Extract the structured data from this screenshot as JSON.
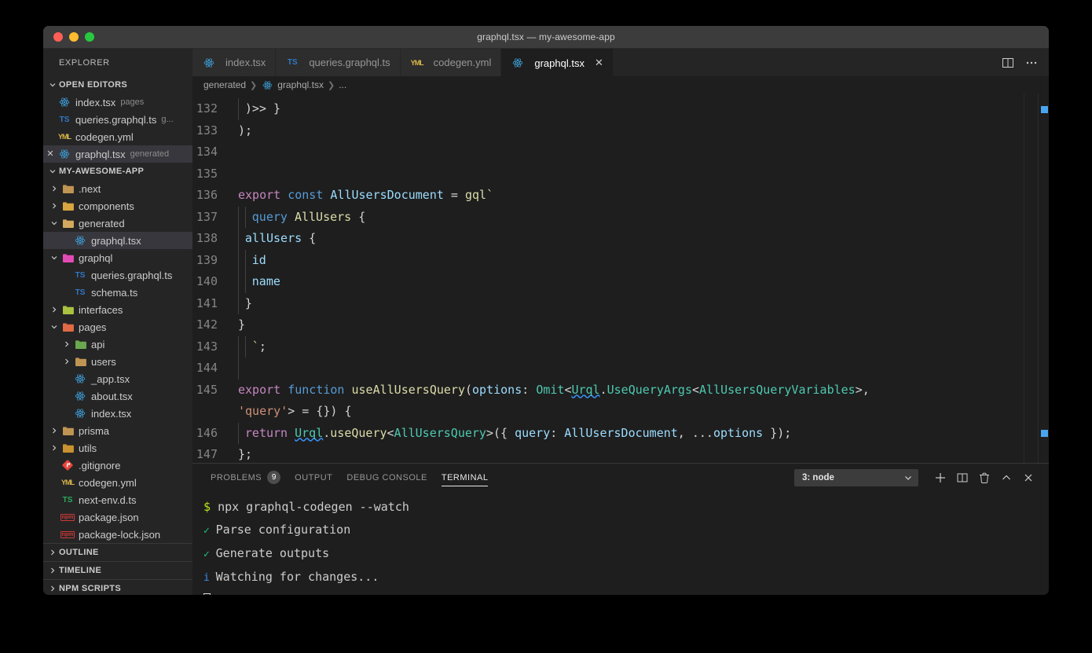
{
  "window": {
    "title": "graphql.tsx — my-awesome-app",
    "traffic_lights": [
      "close",
      "minimize",
      "zoom"
    ]
  },
  "sidebar": {
    "title": "EXPLORER",
    "sections": [
      {
        "name": "OPEN EDITORS",
        "expanded": true
      },
      {
        "name": "MY-AWESOME-APP",
        "expanded": true
      },
      {
        "name": "OUTLINE",
        "expanded": false
      },
      {
        "name": "TIMELINE",
        "expanded": false
      },
      {
        "name": "NPM SCRIPTS",
        "expanded": false
      }
    ],
    "open_editors": [
      {
        "label": "index.tsx",
        "desc": "pages",
        "icon": "react-icon",
        "closable": false,
        "active": false
      },
      {
        "label": "queries.graphql.ts",
        "desc": "g...",
        "icon": "ts-icon",
        "closable": false,
        "active": false
      },
      {
        "label": "codegen.yml",
        "desc": "",
        "icon": "yaml-icon",
        "closable": false,
        "active": false
      },
      {
        "label": "graphql.tsx",
        "desc": "generated",
        "icon": "react-icon",
        "closable": true,
        "active": true
      }
    ],
    "tree": [
      {
        "label": ".next",
        "icon": "folder-icon",
        "depth": 1,
        "twisty": "right",
        "selected": false
      },
      {
        "label": "components",
        "icon": "folder-components-icon",
        "depth": 1,
        "twisty": "right",
        "selected": false
      },
      {
        "label": "generated",
        "icon": "folder-open-icon",
        "depth": 1,
        "twisty": "down",
        "selected": false
      },
      {
        "label": "graphql.tsx",
        "icon": "react-icon",
        "depth": 2,
        "twisty": "none",
        "selected": true
      },
      {
        "label": "graphql",
        "icon": "folder-graphql-icon",
        "depth": 1,
        "twisty": "down",
        "selected": false
      },
      {
        "label": "queries.graphql.ts",
        "icon": "ts-icon",
        "depth": 2,
        "twisty": "none",
        "selected": false
      },
      {
        "label": "schema.ts",
        "icon": "ts-icon",
        "depth": 2,
        "twisty": "none",
        "selected": false
      },
      {
        "label": "interfaces",
        "icon": "folder-interfaces-icon",
        "depth": 1,
        "twisty": "right",
        "selected": false
      },
      {
        "label": "pages",
        "icon": "folder-pages-icon",
        "depth": 1,
        "twisty": "down",
        "selected": false
      },
      {
        "label": "api",
        "icon": "folder-api-icon",
        "depth": 2,
        "twisty": "right",
        "selected": false
      },
      {
        "label": "users",
        "icon": "folder-icon",
        "depth": 2,
        "twisty": "right",
        "selected": false
      },
      {
        "label": "_app.tsx",
        "icon": "react-icon",
        "depth": 2,
        "twisty": "none",
        "selected": false
      },
      {
        "label": "about.tsx",
        "icon": "react-icon",
        "depth": 2,
        "twisty": "none",
        "selected": false
      },
      {
        "label": "index.tsx",
        "icon": "react-icon",
        "depth": 2,
        "twisty": "none",
        "selected": false
      },
      {
        "label": "prisma",
        "icon": "folder-icon",
        "depth": 1,
        "twisty": "right",
        "selected": false
      },
      {
        "label": "utils",
        "icon": "folder-utils-icon",
        "depth": 1,
        "twisty": "right",
        "selected": false
      },
      {
        "label": ".gitignore",
        "icon": "git-icon",
        "depth": 1,
        "twisty": "none",
        "selected": false
      },
      {
        "label": "codegen.yml",
        "icon": "yaml-icon",
        "depth": 1,
        "twisty": "none",
        "selected": false
      },
      {
        "label": "next-env.d.ts",
        "icon": "dts-icon",
        "depth": 1,
        "twisty": "none",
        "selected": false
      },
      {
        "label": "package.json",
        "icon": "npm-icon",
        "depth": 1,
        "twisty": "none",
        "selected": false
      },
      {
        "label": "package-lock.json",
        "icon": "npm-icon",
        "depth": 1,
        "twisty": "none",
        "selected": false
      }
    ]
  },
  "editor": {
    "tabs": [
      {
        "label": "index.tsx",
        "icon": "react-icon",
        "active": false,
        "dirty": false
      },
      {
        "label": "queries.graphql.ts",
        "icon": "ts-icon",
        "active": false,
        "dirty": false
      },
      {
        "label": "codegen.yml",
        "icon": "yaml-icon",
        "active": false,
        "dirty": false
      },
      {
        "label": "graphql.tsx",
        "icon": "react-icon",
        "active": true,
        "dirty": false
      }
    ],
    "actions": [
      "split-editor-icon",
      "more-actions-icon"
    ],
    "breadcrumbs": [
      "generated",
      "graphql.tsx",
      "..."
    ],
    "first_line": 132,
    "lines": [
      {
        "n": 132,
        "text": ")>> }"
      },
      {
        "n": 133,
        "text": ");"
      },
      {
        "n": 134,
        "text": ""
      },
      {
        "n": 135,
        "text": ""
      },
      {
        "n": 136,
        "text": "export const AllUsersDocument = gql`"
      },
      {
        "n": 137,
        "text": "    query AllUsers {"
      },
      {
        "n": 138,
        "text": "  allUsers {"
      },
      {
        "n": 139,
        "text": "    id"
      },
      {
        "n": 140,
        "text": "    name"
      },
      {
        "n": 141,
        "text": "  }"
      },
      {
        "n": 142,
        "text": "}"
      },
      {
        "n": 143,
        "text": "    `;"
      },
      {
        "n": 144,
        "text": ""
      },
      {
        "n": 145,
        "text": "export function useAllUsersQuery(options: Omit<Urql.UseQueryArgs<AllUsersQueryVariables>, 'query'> = {}) {"
      },
      {
        "n": 146,
        "text": "  return Urql.useQuery<AllUsersQuery>({ query: AllUsersDocument, ...options });"
      },
      {
        "n": 147,
        "text": "};"
      }
    ]
  },
  "panel": {
    "tabs": [
      {
        "label": "PROBLEMS",
        "badge": "9",
        "active": false
      },
      {
        "label": "OUTPUT",
        "badge": "",
        "active": false
      },
      {
        "label": "DEBUG CONSOLE",
        "badge": "",
        "active": false
      },
      {
        "label": "TERMINAL",
        "badge": "",
        "active": true
      }
    ],
    "terminal_select": "3: node",
    "actions": [
      "new-terminal-icon",
      "split-terminal-icon",
      "kill-terminal-icon",
      "maximize-panel-icon",
      "close-panel-icon"
    ],
    "terminal_lines": [
      {
        "marker": "$",
        "marker_kind": "prompt",
        "text": "npx graphql-codegen --watch"
      },
      {
        "marker": "✓",
        "marker_kind": "check",
        "text": "Parse configuration"
      },
      {
        "marker": "✓",
        "marker_kind": "check",
        "text": "Generate outputs"
      },
      {
        "marker": "i",
        "marker_kind": "info",
        "text": "Watching for changes..."
      }
    ]
  },
  "colors": {
    "accent_blue": "#3794ff",
    "editor_bg": "#1e1e1e",
    "sidebar_bg": "#252526",
    "titlebar_bg": "#3c3c3c",
    "keyword": "#c586c0",
    "control": "#569cd6",
    "function": "#dcdcaa",
    "variable": "#9cdcfe",
    "type": "#4ec9b0",
    "string": "#ce9178",
    "plain": "#d4d4d4",
    "prompt_green": "#b5e61d",
    "check_green": "#1bc77a",
    "info_blue": "#3b8eea"
  }
}
